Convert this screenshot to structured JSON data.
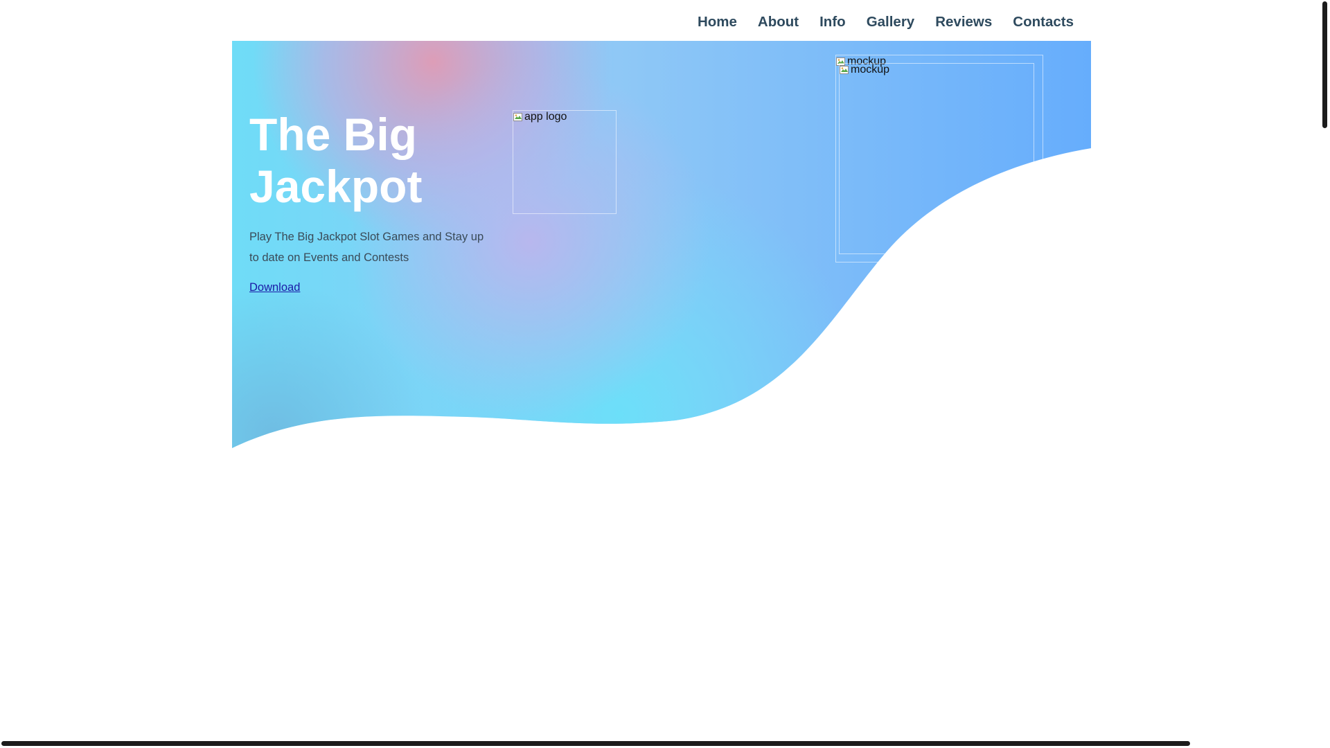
{
  "nav": {
    "items": [
      {
        "label": "Home"
      },
      {
        "label": "About"
      },
      {
        "label": "Info"
      },
      {
        "label": "Gallery"
      },
      {
        "label": "Reviews"
      },
      {
        "label": "Contacts"
      }
    ]
  },
  "hero": {
    "title": "The Big Jackpot",
    "subtitle": "Play The Big Jackpot Slot Games and Stay up to date on Events and Contests",
    "download_label": "Download",
    "logo_alt": "app logo",
    "mockup_alt_1": "mockup",
    "mockup_alt_2": "mockup"
  },
  "colors": {
    "nav_text": "#2e4a5e",
    "hero_cyan": "#6fdcf7",
    "hero_pink": "#d9a0be",
    "hero_blue": "#66adfc",
    "link": "#1a1aa6"
  },
  "icons": {
    "broken_image": "broken-image-icon"
  }
}
